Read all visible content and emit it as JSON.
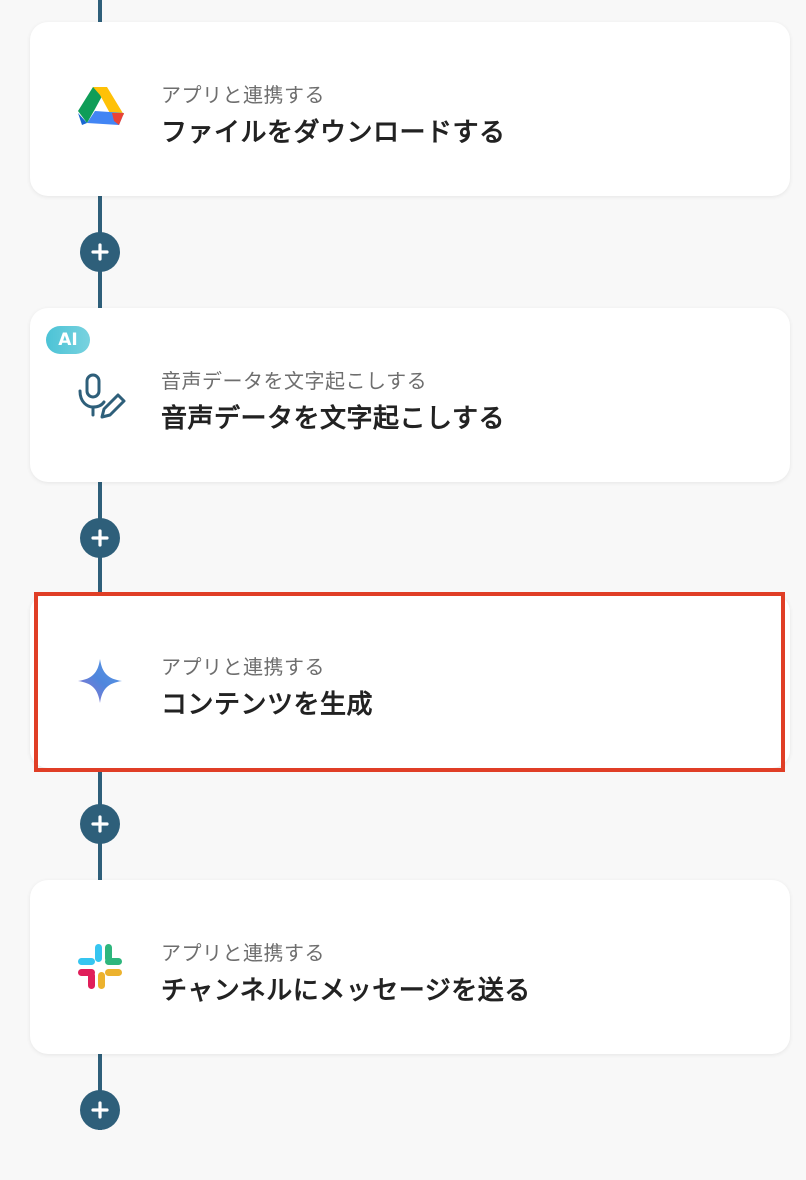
{
  "steps": [
    {
      "subtitle": "アプリと連携する",
      "title": "ファイルをダウンロードする",
      "icon": "google-drive-icon"
    },
    {
      "badge": "AI",
      "subtitle": "音声データを文字起こしする",
      "title": "音声データを文字起こしする",
      "icon": "microphone-pen-icon"
    },
    {
      "subtitle": "アプリと連携する",
      "title": "コンテンツを生成",
      "icon": "gemini-sparkle-icon",
      "highlighted": true
    },
    {
      "subtitle": "アプリと連携する",
      "title": "チャンネルにメッセージを送る",
      "icon": "slack-icon"
    }
  ],
  "add_step_icon": "plus-icon",
  "colors": {
    "connector": "#2e5f7a",
    "highlight_border": "#e03e26",
    "ai_badge": "#4cc3d6",
    "background": "#f8f8f8"
  }
}
